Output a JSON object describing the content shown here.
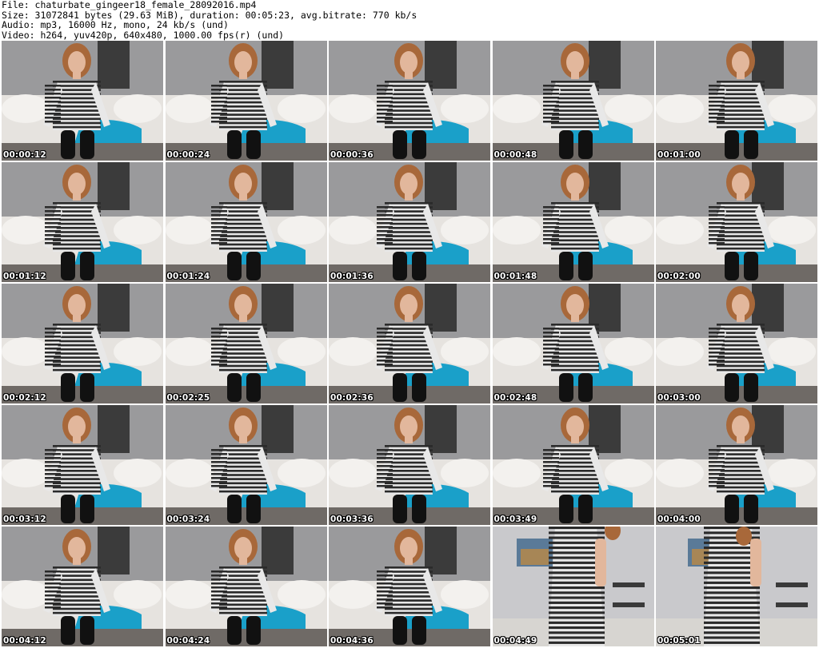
{
  "header": {
    "file_line": "File: chaturbate_gingeer18_female_28092016.mp4",
    "size_line": "Size: 31072841 bytes (29.63 MiB), duration: 00:05:23, avg.bitrate: 770 kb/s",
    "audio_line": "Audio: mp3, 16000 Hz, mono, 24 kb/s (und)",
    "video_line": "Video: h264, yuv420p, 640x480, 1000.00 fps(r) (und)"
  },
  "thumbnails": [
    {
      "timestamp": "00:00:12",
      "scene": "seated"
    },
    {
      "timestamp": "00:00:24",
      "scene": "seated"
    },
    {
      "timestamp": "00:00:36",
      "scene": "seated"
    },
    {
      "timestamp": "00:00:48",
      "scene": "seated"
    },
    {
      "timestamp": "00:01:00",
      "scene": "seated"
    },
    {
      "timestamp": "00:01:12",
      "scene": "seated"
    },
    {
      "timestamp": "00:01:24",
      "scene": "seated"
    },
    {
      "timestamp": "00:01:36",
      "scene": "seated"
    },
    {
      "timestamp": "00:01:48",
      "scene": "seated"
    },
    {
      "timestamp": "00:02:00",
      "scene": "seated"
    },
    {
      "timestamp": "00:02:12",
      "scene": "seated"
    },
    {
      "timestamp": "00:02:25",
      "scene": "seated"
    },
    {
      "timestamp": "00:02:36",
      "scene": "seated"
    },
    {
      "timestamp": "00:02:48",
      "scene": "seated"
    },
    {
      "timestamp": "00:03:00",
      "scene": "seated"
    },
    {
      "timestamp": "00:03:12",
      "scene": "seated"
    },
    {
      "timestamp": "00:03:24",
      "scene": "seated"
    },
    {
      "timestamp": "00:03:36",
      "scene": "seated"
    },
    {
      "timestamp": "00:03:49",
      "scene": "seated"
    },
    {
      "timestamp": "00:04:00",
      "scene": "seated"
    },
    {
      "timestamp": "00:04:12",
      "scene": "seated"
    },
    {
      "timestamp": "00:04:24",
      "scene": "seated"
    },
    {
      "timestamp": "00:04:36",
      "scene": "seated"
    },
    {
      "timestamp": "00:04:49",
      "scene": "standing"
    },
    {
      "timestamp": "00:05:01",
      "scene": "standing"
    }
  ],
  "colors": {
    "wall": "#9a9a9c",
    "sofa": "#e6e3df",
    "blanket": "#1aa0c9",
    "dress_dark": "#2a2a2a",
    "dress_light": "#e8e8e8",
    "hair": "#a8683a",
    "skin": "#e2b79c",
    "stockings": "#111111"
  }
}
